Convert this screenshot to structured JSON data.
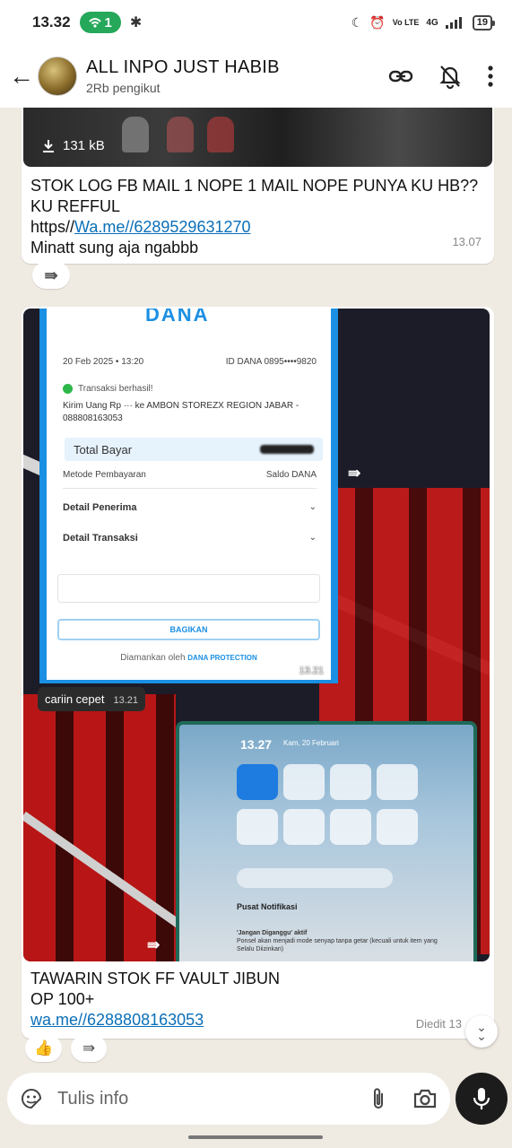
{
  "status_bar": {
    "time": "13.32",
    "hotspot_count": "1",
    "volte": "Vo LTE",
    "network": "4G",
    "battery": "19",
    "icons": [
      "hotspot-icon",
      "gear-icon",
      "moon-icon",
      "alarm-icon",
      "signal-icon",
      "battery-icon"
    ]
  },
  "header": {
    "title": "ALL INPO JUST HABIB",
    "subtitle": "2Rb pengikut",
    "icons": [
      "back-arrow-icon",
      "link-icon",
      "bell-off-icon",
      "more-vertical-icon"
    ]
  },
  "messages": [
    {
      "file_size": "131 kB",
      "text_line1": "STOK LOG FB MAIL 1 NOPE 1 MAIL NOPE PUNYA KU HB?? KU REFFUL",
      "link_prefix": "https//",
      "link": "Wa.me//6289529631270",
      "text_line3": "Minatt sung aja ngabbb",
      "time": "13.07"
    },
    {
      "receipt": {
        "logo": "DANA",
        "date": "20 Feb 2025 • 13:20",
        "id": "ID DANA 0895••••9820",
        "status": "Transaksi berhasil!",
        "kirim": "Kirim Uang Rp ··· ke AMBON STOREZX REGION JABAR - 088808163053",
        "total_label": "Total Bayar",
        "metode_label": "Metode Pembayaran",
        "metode_value": "Saldo DANA",
        "detail_penerima": "Detail Penerima",
        "detail_transaksi": "Detail Transaksi",
        "bagikan": "BAGIKAN",
        "secured_by": "Diamankan oleh",
        "protection": "DANA PROTECTION",
        "time": "13.21"
      },
      "caption": "cariin cepet",
      "caption_time": "13.21",
      "control_center": {
        "time": "13.27",
        "date": "Kam, 20 Februari",
        "notif_title": "Pusat Notifikasi",
        "dnd_title": "'Jangan Diganggu' aktif",
        "dnd_text": "Ponsel akan menjadi mode senyap tanpa getar (kecuali untuk item yang Selalu Diizinkan)"
      },
      "text_line1": "TAWARIN STOK FF VAULT JIBUN",
      "text_line2": "OP 100+",
      "link": "wa.me//6288808163053",
      "time": "Diedit 13"
    }
  ],
  "reactions": [
    "👍"
  ],
  "input": {
    "placeholder": "Tulis info",
    "icons": [
      "sticker-icon",
      "attach-icon",
      "camera-icon",
      "mic-icon"
    ]
  }
}
